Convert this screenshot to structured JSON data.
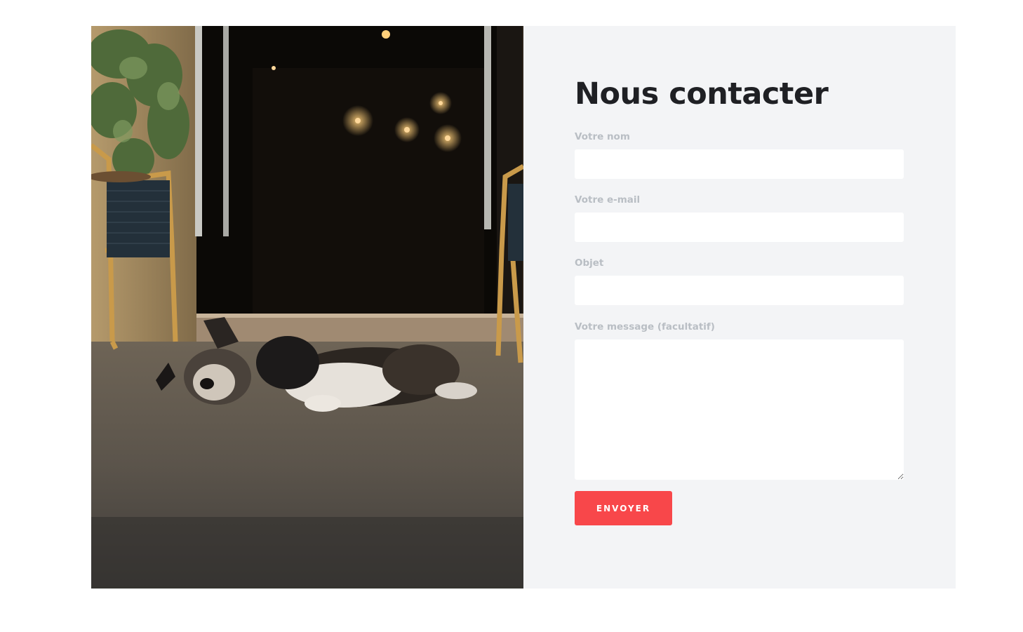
{
  "contact": {
    "title": "Nous contacter",
    "fields": [
      {
        "label": "Votre nom",
        "value": "",
        "placeholder": ""
      },
      {
        "label": "Votre e-mail",
        "value": "",
        "placeholder": ""
      },
      {
        "label": "Objet",
        "value": "",
        "placeholder": ""
      }
    ],
    "message": {
      "label": "Votre message (facultatif)",
      "value": "",
      "placeholder": ""
    },
    "submit_label": "ENVOYER"
  },
  "colors": {
    "panel_background": "#f3f4f6",
    "title": "#1f2024",
    "label": "#b9bec4",
    "accent": "#f8474a"
  },
  "image": {
    "subject": "dog sleeping on terrace in front of cafe doorway"
  }
}
